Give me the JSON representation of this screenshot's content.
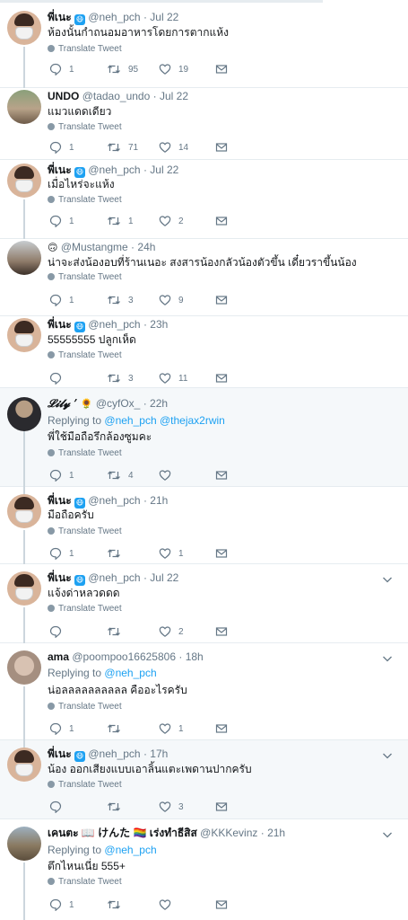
{
  "tweets": [
    {
      "name": "พี่เนะ",
      "emoji": "mask-emoji",
      "handle": "@neh_pch",
      "time": "Jul 22",
      "text": "ห้องนั้นกำถนอมอาหารโดยการตากแห้ง",
      "translate": "Translate Tweet",
      "replies": "1",
      "retweets": "95",
      "likes": "19"
    },
    {
      "name": "UNDO",
      "handle": "@tadao_undo",
      "time": "Jul 22",
      "text": "แมวแดดเดียว",
      "translate": "Translate Tweet",
      "replies": "1",
      "retweets": "71",
      "likes": "14"
    },
    {
      "name": "พี่เนะ",
      "emoji": "mask-emoji",
      "handle": "@neh_pch",
      "time": "Jul 22",
      "text": "เมื่อไหร่จะแห้ง",
      "translate": "Translate Tweet",
      "replies": "1",
      "retweets": "1",
      "likes": "2"
    },
    {
      "name": "",
      "emoji": "smile-emoji",
      "handle": "@Mustangme",
      "time": "24h",
      "text": "น่าจะส่งน้องอบที่ร้านเนอะ สงสารน้องกลัวน้องตัวขึ้น เดี๋ยวราขึ้นน้อง",
      "translate": "Translate Tweet",
      "replies": "1",
      "retweets": "3",
      "likes": "9"
    },
    {
      "name": "พี่เนะ",
      "emoji": "mask-emoji",
      "handle": "@neh_pch",
      "time": "23h",
      "text": "55555555 ปลูกเห็ด",
      "translate": "Translate Tweet",
      "replies": "",
      "retweets": "3",
      "likes": "11"
    },
    {
      "name": "𝓛𝓲𝓵𝔂 ’",
      "emoji": "sunflower-emoji",
      "handle": "@cyfOx_",
      "time": "22h",
      "reply_label": "Replying to",
      "reply_mentions": "@neh_pch @thejax2rwin",
      "text": "พี่ใช้มือถือรึกล้องซูมคะ",
      "translate": "Translate Tweet",
      "replies": "1",
      "retweets": "4",
      "likes": ""
    },
    {
      "name": "พี่เนะ",
      "emoji": "mask-emoji",
      "handle": "@neh_pch",
      "time": "21h",
      "text": "มือถือครับ",
      "translate": "Translate Tweet",
      "replies": "1",
      "retweets": "",
      "likes": "1"
    },
    {
      "name": "พี่เนะ",
      "emoji": "mask-emoji",
      "handle": "@neh_pch",
      "time": "Jul 22",
      "text": "แจ้งด่าหลวดดด",
      "translate": "Translate Tweet",
      "replies": "",
      "retweets": "",
      "likes": "2"
    },
    {
      "name": "ama",
      "handle": "@poompoo16625806",
      "time": "18h",
      "reply_label": "Replying to",
      "reply_mentions": "@neh_pch",
      "text": "น่อลลลลลลลลลล คืออะไรครับ",
      "translate": "Translate Tweet",
      "replies": "1",
      "retweets": "",
      "likes": "1"
    },
    {
      "name": "พี่เนะ",
      "emoji": "mask-emoji",
      "handle": "@neh_pch",
      "time": "17h",
      "text": "น้อง ออกเสียงแบบเอาลิ้นแตะเพดานปากครับ",
      "translate": "Translate Tweet",
      "replies": "",
      "retweets": "",
      "likes": "3"
    },
    {
      "name": "เคนตะ 📖 けんた 🏳️‍🌈 เร่งทำธีสิส",
      "handle": "@KKKevinz",
      "time": "21h",
      "reply_label": "Replying to",
      "reply_mentions": "@neh_pch",
      "text": "ตึกไหนเนี่ย 555+",
      "translate": "Translate Tweet",
      "replies": "1",
      "retweets": "",
      "likes": ""
    }
  ],
  "separator": "·",
  "emojis": {
    "mask-emoji": "😷",
    "smile-emoji": "🙃",
    "sunflower-emoji": "🌻"
  },
  "colors": {
    "accent": "#1da1f2",
    "muted": "#657786",
    "thread": "#ccd6dd",
    "highlight_bg": "#f5f8fa"
  }
}
